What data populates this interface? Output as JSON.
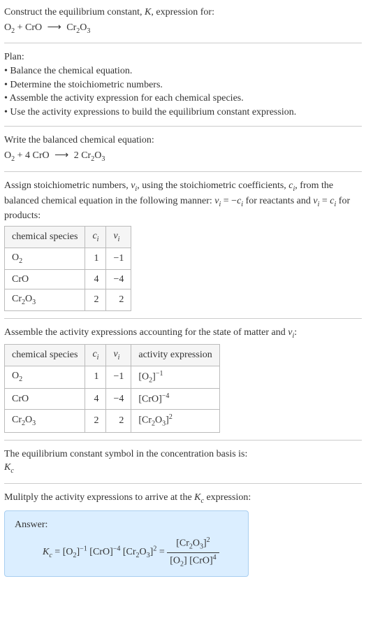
{
  "title": {
    "line1_prefix": "Construct the equilibrium constant, ",
    "K": "K",
    "line1_suffix": ", expression for:"
  },
  "eq1": {
    "O2": "O",
    "O2_sub": "2",
    "plus": " + ",
    "CrO": "CrO",
    "arrow": "⟶",
    "Cr2O3": "Cr",
    "Cr2O3_sub1": "2",
    "Cr2O3_mid": "O",
    "Cr2O3_sub2": "3"
  },
  "plan": {
    "heading": "Plan:",
    "b1": "• Balance the chemical equation.",
    "b2": "• Determine the stoichiometric numbers.",
    "b3": "• Assemble the activity expression for each chemical species.",
    "b4": "• Use the activity expressions to build the equilibrium constant expression."
  },
  "balanced": {
    "heading": "Write the balanced chemical equation:",
    "O2": "O",
    "O2_sub": "2",
    "plus": " + 4 CrO ",
    "arrow": "⟶",
    "rhs": " 2 Cr",
    "rhs_sub1": "2",
    "rhs_mid": "O",
    "rhs_sub2": "3"
  },
  "stoich": {
    "text1": "Assign stoichiometric numbers, ",
    "nu": "ν",
    "nu_sub": "i",
    "text2": ", using the stoichiometric coefficients, ",
    "c": "c",
    "c_sub": "i",
    "text3": ", from the balanced chemical equation in the following manner: ",
    "rel1a": "ν",
    "rel1a_sub": "i",
    "rel1_eq": " = −",
    "rel1b": "c",
    "rel1b_sub": "i",
    "text4": " for reactants and ",
    "rel2a": "ν",
    "rel2a_sub": "i",
    "rel2_eq": " = ",
    "rel2b": "c",
    "rel2b_sub": "i",
    "text5": " for products:"
  },
  "table1": {
    "h1": "chemical species",
    "h2": "c",
    "h2_sub": "i",
    "h3": "ν",
    "h3_sub": "i",
    "r1": {
      "sp": "O",
      "sp_sub": "2",
      "c": "1",
      "nu": "−1"
    },
    "r2": {
      "sp": "CrO",
      "c": "4",
      "nu": "−4"
    },
    "r3": {
      "sp_a": "Cr",
      "sp_sub1": "2",
      "sp_b": "O",
      "sp_sub2": "3",
      "c": "2",
      "nu": "2"
    }
  },
  "assemble": {
    "text1": "Assemble the activity expressions accounting for the state of matter and ",
    "nu": "ν",
    "nu_sub": "i",
    "text2": ":"
  },
  "table2": {
    "h1": "chemical species",
    "h2": "c",
    "h2_sub": "i",
    "h3": "ν",
    "h3_sub": "i",
    "h4": "activity expression",
    "r1": {
      "sp": "O",
      "sp_sub": "2",
      "c": "1",
      "nu": "−1",
      "ae_a": "[O",
      "ae_sub": "2",
      "ae_b": "]",
      "ae_sup": "−1"
    },
    "r2": {
      "sp": "CrO",
      "c": "4",
      "nu": "−4",
      "ae_a": "[CrO]",
      "ae_sup": "−4"
    },
    "r3": {
      "sp_a": "Cr",
      "sp_sub1": "2",
      "sp_b": "O",
      "sp_sub2": "3",
      "c": "2",
      "nu": "2",
      "ae_a": "[Cr",
      "ae_sub1": "2",
      "ae_b": "O",
      "ae_sub2": "3",
      "ae_c": "]",
      "ae_sup": "2"
    }
  },
  "basis": {
    "text": "The equilibrium constant symbol in the concentration basis is:",
    "Kc": "K",
    "Kc_sub": "c"
  },
  "multiply": {
    "text1": "Mulitply the activity expressions to arrive at the ",
    "Kc": "K",
    "Kc_sub": "c",
    "text2": " expression:"
  },
  "answer": {
    "label": "Answer:",
    "Kc": "K",
    "Kc_sub": "c",
    "eq": " = ",
    "t1": "[O",
    "t1_sub": "2",
    "t1b": "]",
    "t1_sup": "−1",
    "t2": " [CrO]",
    "t2_sup": "−4",
    "t3": " [Cr",
    "t3_sub1": "2",
    "t3b": "O",
    "t3_sub2": "3",
    "t3c": "]",
    "t3_sup": "2",
    "eq2": " = ",
    "num_a": "[Cr",
    "num_sub1": "2",
    "num_b": "O",
    "num_sub2": "3",
    "num_c": "]",
    "num_sup": "2",
    "den_a": "[O",
    "den_sub1": "2",
    "den_b": "] [CrO]",
    "den_sup": "4"
  }
}
